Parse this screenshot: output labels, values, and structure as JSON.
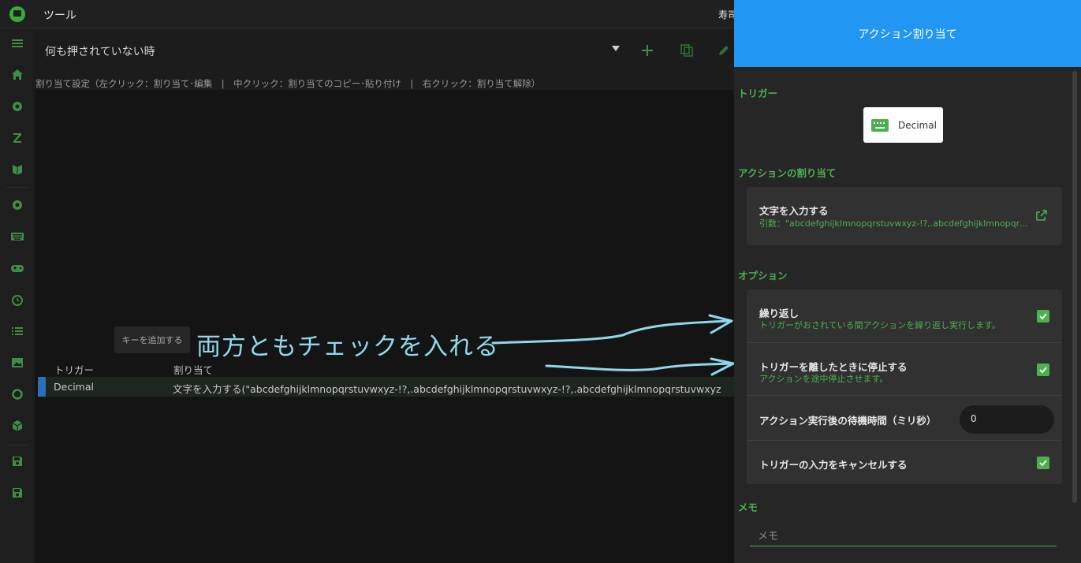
{
  "window": {
    "title": "ツール",
    "profile_name": "寿司"
  },
  "main": {
    "state_label": "何も押されていない時",
    "hint": "割り当て設定（左クリック：割り当て･編集　|　中クリック：割り当てのコピー･貼り付け　|　右クリック：割り当て解除）",
    "add_key_label": "キーを追加する",
    "annotation": "両方ともチェックを入れる",
    "table": {
      "headers": {
        "trigger": "トリガー",
        "assignment": "割り当て"
      },
      "rows": [
        {
          "trigger": "Decimal",
          "assignment": "文字を入力する(\"abcdefghijklmnopqrstuvwxyz-!?,.abcdefghijklmnopqrstuvwxyz-!?,.abcdefghijklmnopqrstuvwxyz-!?,.abcd..."
        }
      ]
    }
  },
  "panel": {
    "title": "アクション割り当て",
    "trigger_section": "トリガー",
    "trigger_key": "Decimal",
    "action_section": "アクションの割り当て",
    "action": {
      "name": "文字を入力する",
      "argument": "引数：\"abcdefghijklmnopqrstuvwxyz-!?,.abcdefghijklmnopqrstu..."
    },
    "options_section": "オプション",
    "options": {
      "repeat": {
        "label": "繰り返し",
        "desc": "トリガーがおされている間アクションを繰り返し実行します。",
        "checked": true
      },
      "stop_on_release": {
        "label": "トリガーを離したときに停止する",
        "desc": "アクションを途中停止させます。",
        "checked": true
      },
      "wait_after": {
        "label": "アクション実行後の待機時間（ミリ秒）",
        "value": "0"
      },
      "cancel_input": {
        "label": "トリガーの入力をキャンセルする",
        "checked": true
      }
    },
    "memo_section": "メモ",
    "memo_placeholder": "メモ"
  },
  "colors": {
    "accent": "#4caf50",
    "header": "#2196f3",
    "annotation": "#8fd8ea"
  }
}
